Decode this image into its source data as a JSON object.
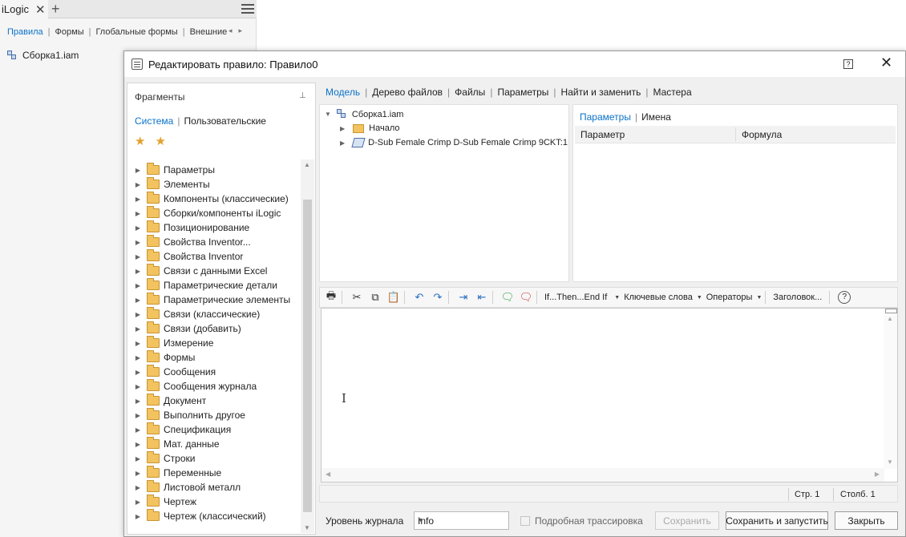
{
  "ilogic": {
    "tab_title": "iLogic",
    "close_glyph": "✕",
    "add_glyph": "+",
    "subtabs": [
      "Правила",
      "Формы",
      "Глобальные формы",
      "Внешние"
    ],
    "tree_item": "Сборка1.iam"
  },
  "dialog": {
    "title": "Редактировать правило: Правило0",
    "help_glyph": "?",
    "close_glyph": "✕"
  },
  "fragments": {
    "title": "Фрагменты",
    "tabs": [
      "Система",
      "Пользовательские"
    ],
    "items": [
      "Параметры",
      "Элементы",
      "Компоненты (классические)",
      "Сборки/компоненты iLogic",
      "Позиционирование",
      "Свойства Inventor...",
      "Свойства Inventor",
      "Связи с данными Excel",
      "Параметрические детали",
      "Параметрические элементы",
      "Связи (классические)",
      "Связи (добавить)",
      "Измерение",
      "Формы",
      "Сообщения",
      "Сообщения журнала",
      "Документ",
      "Выполнить другое",
      "Спецификация",
      "Мат. данные",
      "Строки",
      "Переменные",
      "Листовой металл",
      "Чертеж",
      "Чертеж (классический)"
    ]
  },
  "model_tabs": [
    "Модель",
    "Дерево файлов",
    "Файлы",
    "Параметры",
    "Найти и заменить",
    "Мастера"
  ],
  "model_tree": {
    "root": "Сборка1.iam",
    "children": [
      "Начало",
      "D-Sub Female Crimp D-Sub Female Crimp 9CKT:1"
    ]
  },
  "params": {
    "tabs": [
      "Параметры",
      "Имена"
    ],
    "columns": [
      "Параметр",
      "Формула"
    ]
  },
  "toolbar": {
    "if_then": "If...Then...End If",
    "keywords": "Ключевые слова",
    "operators": "Операторы",
    "header": "Заголовок...",
    "help_glyph": "?"
  },
  "editor": {
    "cursor_glyph": "I"
  },
  "status": {
    "line": "Стр. 1",
    "column": "Столб. 1"
  },
  "bottom": {
    "log_level_label": "Уровень журнала",
    "log_level_value": "Info",
    "trace_label": "Подробная трассировка",
    "save": "Сохранить",
    "save_run": "Сохранить и запустить",
    "close": "Закрыть"
  },
  "colors": {
    "accent": "#0a72c9",
    "folder": "#f2c35e",
    "star": "#e2a22b"
  }
}
